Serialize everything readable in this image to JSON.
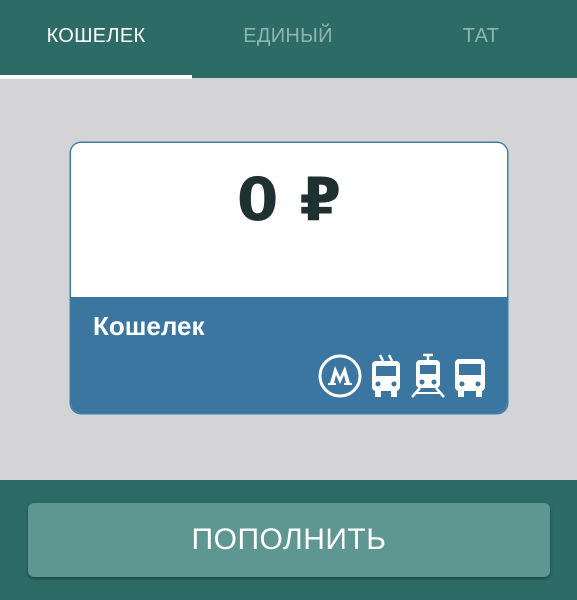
{
  "tabs": [
    {
      "label": "КОШЕЛЕК",
      "active": true
    },
    {
      "label": "ЕДИНЫЙ",
      "active": false
    },
    {
      "label": "ТАТ",
      "active": false
    }
  ],
  "card": {
    "balance": "0 ₽",
    "name": "Кошелек",
    "icons": [
      "metro-icon",
      "trolleybus-icon",
      "tram-icon",
      "bus-icon"
    ]
  },
  "topup_button": {
    "label": "ПОПОЛНИТЬ"
  },
  "colors": {
    "header": "#2c6b66",
    "background": "#d4d4d6",
    "card_accent": "#3b76a0",
    "button": "#5e9791",
    "text_light": "#ffffff",
    "text_inactive": "#8fb5b1",
    "text_dark": "#1f3030"
  }
}
